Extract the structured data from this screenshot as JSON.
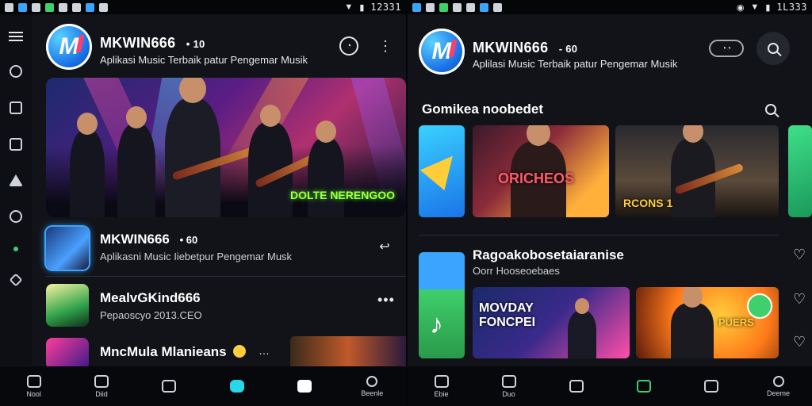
{
  "left": {
    "status": {
      "time": "12331"
    },
    "header": {
      "app_name": "MKWIN666",
      "badge": "• 10",
      "tagline": "Aplikasi Music Terbaik patur Pengemar Musik"
    },
    "hero": {
      "caption": "DOLTE NERENGOO"
    },
    "list": [
      {
        "title": "MKWIN666",
        "badge": "• 60",
        "subtitle": "Aplikasni Music Iiebetpur Pengemar Musk"
      },
      {
        "title": "MealvGKind666",
        "subtitle": "Pepaoscyo 2013.CEO"
      },
      {
        "title": "MncMula Mlanieans",
        "badge": "…"
      }
    ],
    "nav": [
      {
        "label": "Nool"
      },
      {
        "label": "Diid"
      },
      {
        "label": ""
      },
      {
        "label": ""
      },
      {
        "label": ""
      },
      {
        "label": "Beenle"
      }
    ]
  },
  "right": {
    "status": {
      "time": "1L333"
    },
    "header": {
      "app_name": "MKWIN666",
      "badge": "- 60",
      "tagline": "Aplilasi Music Terbaik patur Pengemar Musik"
    },
    "section1": {
      "title": "Gomikea noobedet",
      "cards": [
        {
          "label": "ORICHEOS"
        },
        {
          "label": "RCONS 1"
        }
      ]
    },
    "section2": {
      "title": "Ragoakobosetaiaranise",
      "subtitle": "Oorr Hooseoebaes",
      "cards": [
        {
          "label": "MOVDAY FONCPEI"
        },
        {
          "label": "PUERS"
        }
      ]
    },
    "nav": [
      {
        "label": "Ebie"
      },
      {
        "label": "Duo"
      },
      {
        "label": ""
      },
      {
        "label": ""
      },
      {
        "label": ""
      },
      {
        "label": "Deeme"
      }
    ]
  },
  "colors": {
    "accent": "#29d8e6",
    "brand": "#1b74e8",
    "green": "#3fcf6b"
  }
}
